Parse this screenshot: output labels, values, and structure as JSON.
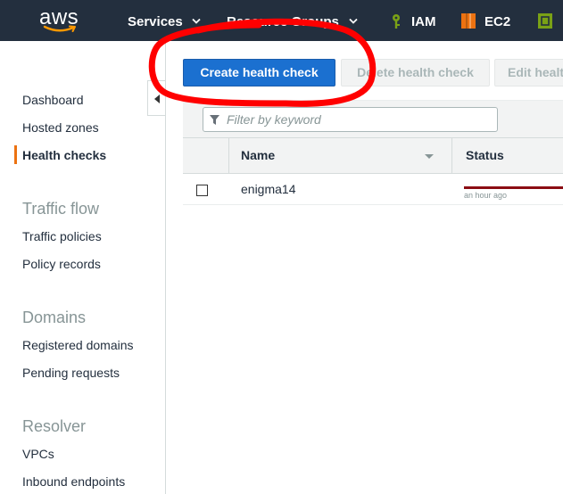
{
  "topnav": {
    "logo_text": "aws",
    "services": "Services",
    "resource_groups": "Resource Groups",
    "shortcuts": [
      {
        "label": "IAM",
        "icon": "iam-key-icon",
        "color": "#7aa116"
      },
      {
        "label": "EC2",
        "icon": "ec2-chip-icon",
        "color": "#ec7211"
      },
      {
        "label": "",
        "icon": "service-cube-icon",
        "color": "#7aa116"
      }
    ]
  },
  "sidebar": {
    "items": [
      {
        "label": "Dashboard"
      },
      {
        "label": "Hosted zones"
      },
      {
        "label": "Health checks",
        "active": true
      }
    ],
    "sections": [
      {
        "heading": "Traffic flow",
        "items": [
          "Traffic policies",
          "Policy records"
        ]
      },
      {
        "heading": "Domains",
        "items": [
          "Registered domains",
          "Pending requests"
        ]
      },
      {
        "heading": "Resolver",
        "items": [
          "VPCs",
          "Inbound endpoints"
        ]
      }
    ]
  },
  "toolbar": {
    "create_label": "Create health check",
    "delete_label": "Delete health check",
    "edit_label": "Edit healt"
  },
  "filter": {
    "placeholder": "Filter by keyword"
  },
  "table": {
    "columns": [
      "Name",
      "Status"
    ],
    "rows": [
      {
        "name": "enigma14",
        "status_time": "an hour ago",
        "status_color": "#8b0d14"
      }
    ]
  },
  "annotation": {
    "color": "#ff0000"
  }
}
